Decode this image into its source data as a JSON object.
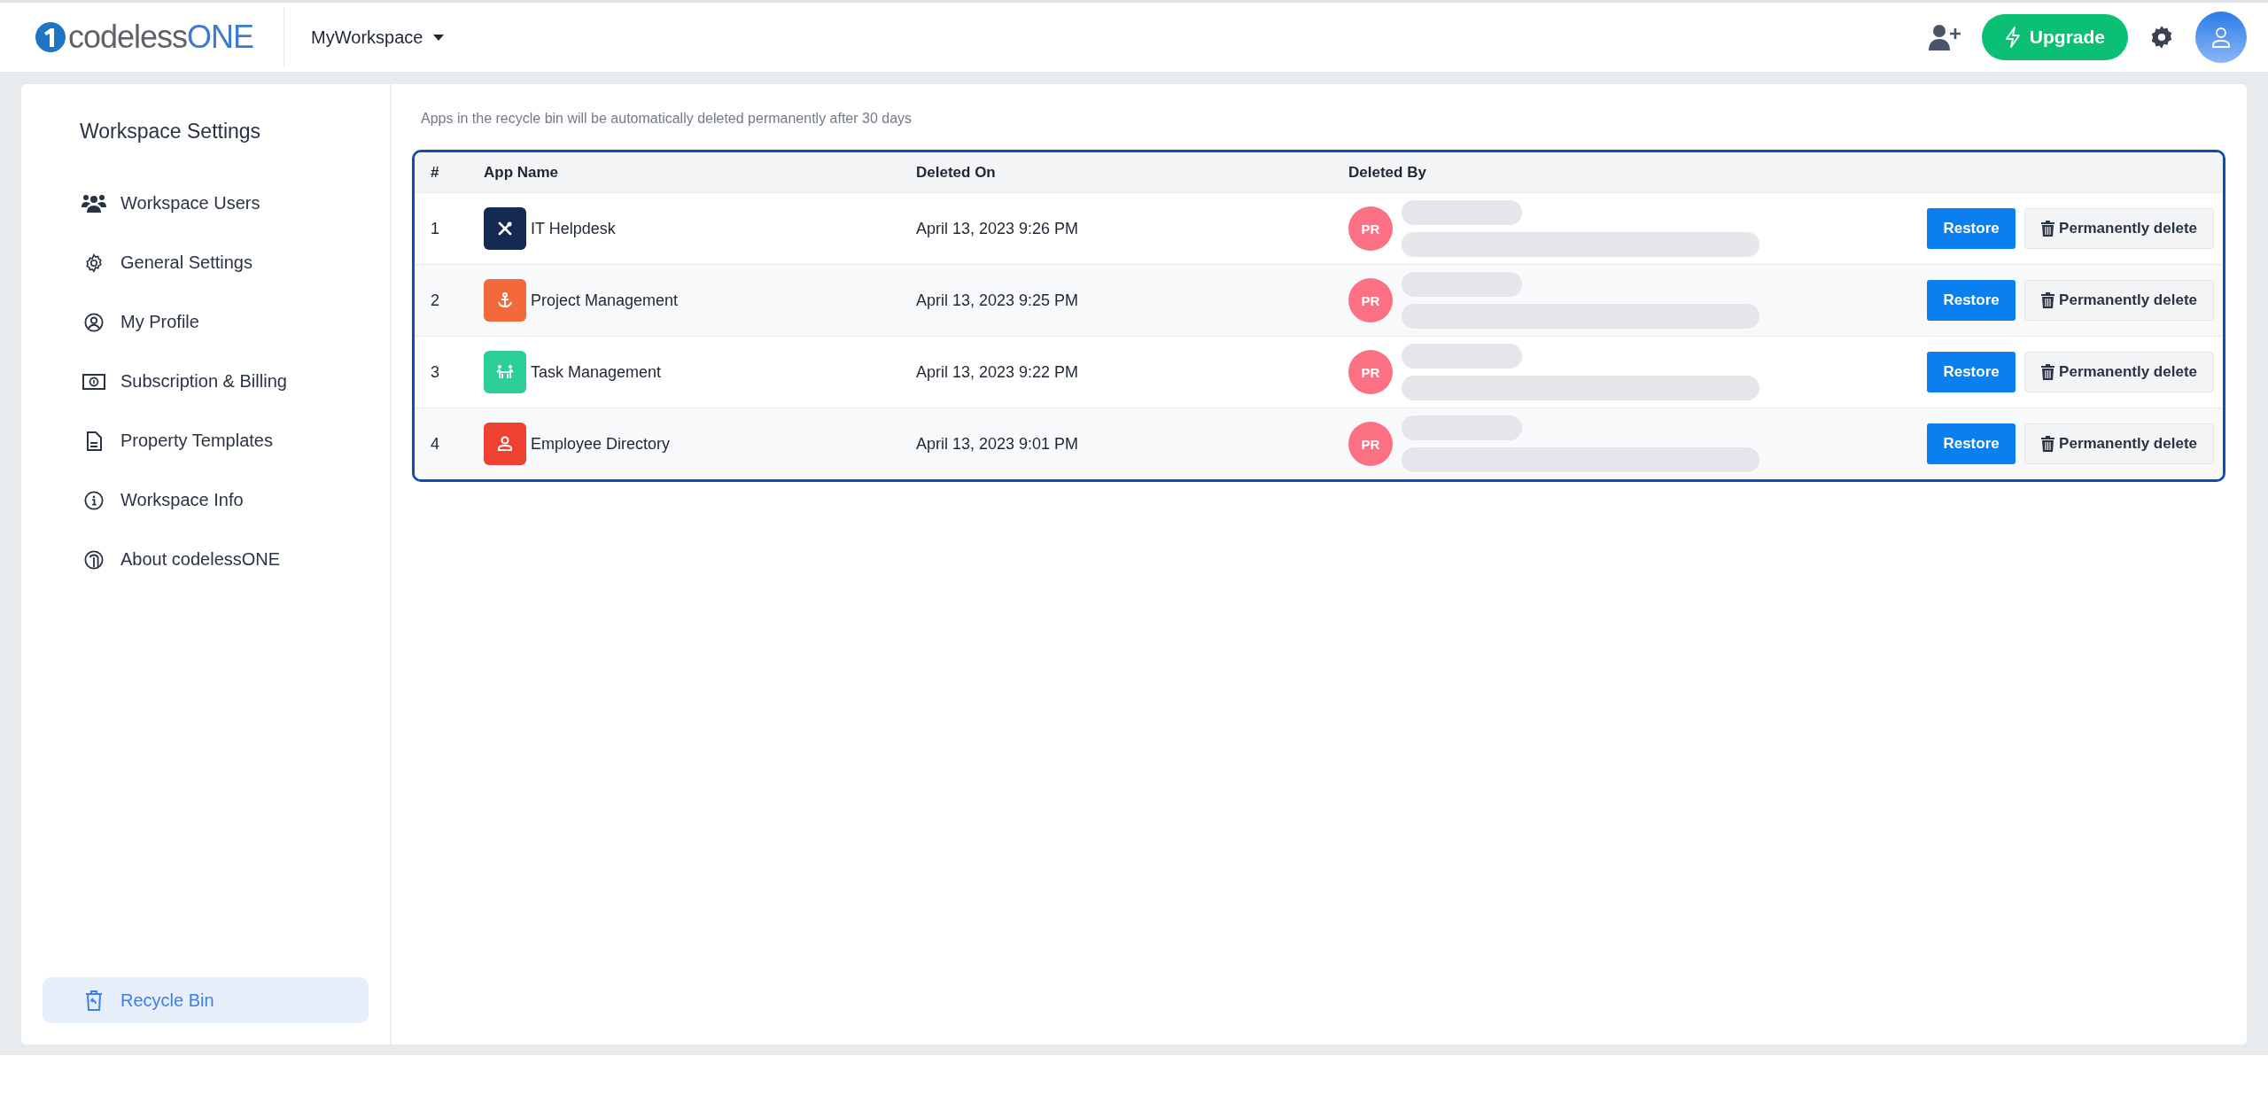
{
  "header": {
    "logo": {
      "part_1": "codeless",
      "part_2": "ONE"
    },
    "workspace": "MyWorkspace",
    "upgrade": "Upgrade"
  },
  "sidebar": {
    "title": "Workspace Settings",
    "items": [
      {
        "label": "Workspace Users",
        "kind": "users",
        "selected": false
      },
      {
        "label": "General Settings",
        "kind": "gear",
        "selected": false
      },
      {
        "label": "My Profile",
        "kind": "profile",
        "selected": false
      },
      {
        "label": "Subscription & Billing",
        "kind": "money",
        "selected": false
      },
      {
        "label": "Property Templates",
        "kind": "document",
        "selected": false
      },
      {
        "label": "Workspace Info",
        "kind": "info",
        "selected": false
      },
      {
        "label": "About codelessONE",
        "kind": "logo",
        "selected": false
      }
    ],
    "footer_item": {
      "label": "Recycle Bin",
      "selected": true
    }
  },
  "notice": "Apps in the recycle bin will be automatically deleted permanently after 30 days",
  "table": {
    "columns": [
      "#",
      "App Name",
      "Deleted On",
      "Deleted By"
    ],
    "rows": [
      {
        "index": "1",
        "app": "IT Helpdesk",
        "kind": "tools",
        "color": "#152a52",
        "deleted_on": "April 13, 2023 9:26 PM",
        "initials": "PR",
        "restore": "Restore",
        "delete": "Permanently delete"
      },
      {
        "index": "2",
        "app": "Project Management",
        "kind": "anchor",
        "color": "#f2693a",
        "deleted_on": "April 13, 2023 9:25 PM",
        "initials": "PR",
        "restore": "Restore",
        "delete": "Permanently delete"
      },
      {
        "index": "3",
        "app": "Task Management",
        "kind": "people",
        "color": "#2ccf95",
        "deleted_on": "April 13, 2023 9:22 PM",
        "initials": "PR",
        "restore": "Restore",
        "delete": "Permanently delete"
      },
      {
        "index": "4",
        "app": "Employee Directory",
        "kind": "person",
        "color": "#ee4131",
        "deleted_on": "April 13, 2023 9:01 PM",
        "initials": "PR",
        "restore": "Restore",
        "delete": "Permanently delete"
      }
    ]
  }
}
